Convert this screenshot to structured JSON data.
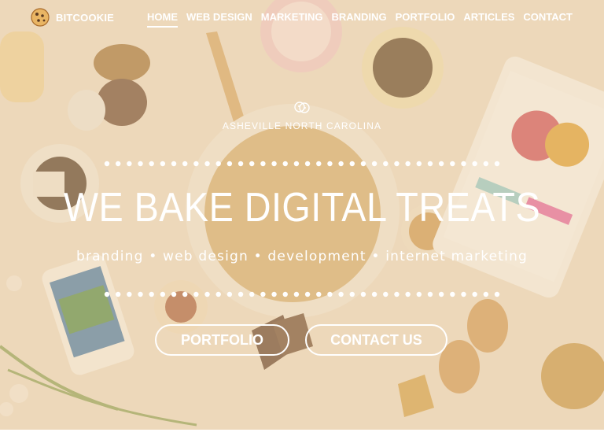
{
  "brand": {
    "name": "BITCOOKIE",
    "logo_icon": "cookie-icon"
  },
  "nav": {
    "items": [
      {
        "label": "HOME",
        "active": true
      },
      {
        "label": "WEB DESIGN",
        "active": false
      },
      {
        "label": "MARKETING",
        "active": false
      },
      {
        "label": "BRANDING",
        "active": false
      },
      {
        "label": "PORTFOLIO",
        "active": false
      },
      {
        "label": "ARTICLES",
        "active": false
      },
      {
        "label": "CONTACT",
        "active": false
      }
    ]
  },
  "hero": {
    "icon": "cookies-icon",
    "location": "ASHEVILLE NORTH CAROLINA",
    "headline": "WE BAKE DIGITAL TREATS",
    "tagline": "branding • web design • development • internet marketing",
    "buttons": {
      "portfolio": "PORTFOLIO",
      "contact": "CONTACT US"
    }
  },
  "colors": {
    "overlay": "#e8cda0",
    "text": "#ffffff",
    "background": "#f3e4cc"
  }
}
